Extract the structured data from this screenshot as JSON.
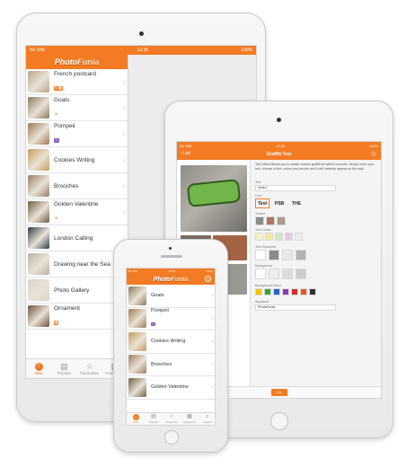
{
  "colors": {
    "accent": "#f37b23"
  },
  "big_ipad": {
    "status": {
      "carrier": "No SIM",
      "time": "12:36",
      "battery": "100%"
    },
    "logo": {
      "part1": "Photo",
      "part2": "Funia"
    },
    "items": [
      {
        "title": "French postcard",
        "badge": "new-box",
        "thumb": "#b8a58a"
      },
      {
        "title": "Goats",
        "badge": "star",
        "thumb": "#8c7a5e"
      },
      {
        "title": "Pompeii",
        "badge": "user",
        "thumb": "#a07855"
      },
      {
        "title": "Cookies Writing",
        "badge": "",
        "thumb": "#c99a5b"
      },
      {
        "title": "Brooches",
        "badge": "",
        "thumb": "#9c7c63"
      },
      {
        "title": "Golden Valentine",
        "badge": "star",
        "thumb": "#6e5d42"
      },
      {
        "title": "London Calling",
        "badge": "",
        "thumb": "#2f3a44"
      },
      {
        "title": "Drawing near the Sea",
        "badge": "",
        "thumb": "#b9b2a4"
      },
      {
        "title": "Photo Gallery",
        "badge": "",
        "thumb": "#d9d4c9"
      },
      {
        "title": "Ornament",
        "badge": "box",
        "thumb": "#6f4f3b"
      }
    ],
    "tabs": [
      {
        "label": "New",
        "icon": "!"
      },
      {
        "label": "Popular",
        "icon": "▤"
      },
      {
        "label": "Favourites",
        "icon": "☆"
      },
      {
        "label": "Categories",
        "icon": "▦"
      }
    ]
  },
  "small_ipad": {
    "status": {
      "carrier": "No SIM",
      "time": "12:35",
      "battery": "100%"
    },
    "back_label": "List",
    "title": "Graffiti Text",
    "description": "This effect allows you to create custom graffiti art within seconds. Simply enter your text, choose a font, colour and texture and it will instantly appear on the wall.",
    "text_label": "Text",
    "text_value": "Hello!",
    "font_label": "Font",
    "font_options": [
      "Text",
      "PSB",
      "THE"
    ],
    "texture_label": "Texture",
    "text_colour_label": "Text Colour",
    "text_ornament_label": "Text Ornament",
    "background_label": "Background",
    "background_colour_label": "Background colour",
    "signature_label": "Signature",
    "signature_value": "PhotoFunia",
    "go_label": "Go",
    "text_colours": [
      "#f2f2c8",
      "#f5ec9a",
      "#cfe8c5",
      "#e7c6e6",
      "#eeeeee"
    ],
    "bg_colours": [
      "#f2c300",
      "#3aa035",
      "#2a64c9",
      "#8b3bb8",
      "#d32f2f",
      "#e8551f",
      "#333333"
    ]
  },
  "iphone": {
    "status": {
      "carrier": "No SIM",
      "time": "12:36",
      "battery": "100%"
    },
    "logo": {
      "part1": "Photo",
      "part2": "Funia"
    },
    "items": [
      {
        "title": "Goats",
        "badge": "",
        "thumb": "#8c7a5e"
      },
      {
        "title": "Pompeii",
        "badge": "user",
        "thumb": "#a07855"
      },
      {
        "title": "Cookies Writing",
        "badge": "",
        "thumb": "#c99a5b"
      },
      {
        "title": "Brooches",
        "badge": "",
        "thumb": "#9c7c63"
      },
      {
        "title": "Golden Valentine",
        "badge": "",
        "thumb": "#6e5d42"
      }
    ],
    "tabs": [
      {
        "label": "New",
        "icon": "!"
      },
      {
        "label": "Popular",
        "icon": "▤"
      },
      {
        "label": "Favourites",
        "icon": "☆"
      },
      {
        "label": "Categories",
        "icon": "▦"
      },
      {
        "label": "Search",
        "icon": "⌕"
      }
    ]
  }
}
